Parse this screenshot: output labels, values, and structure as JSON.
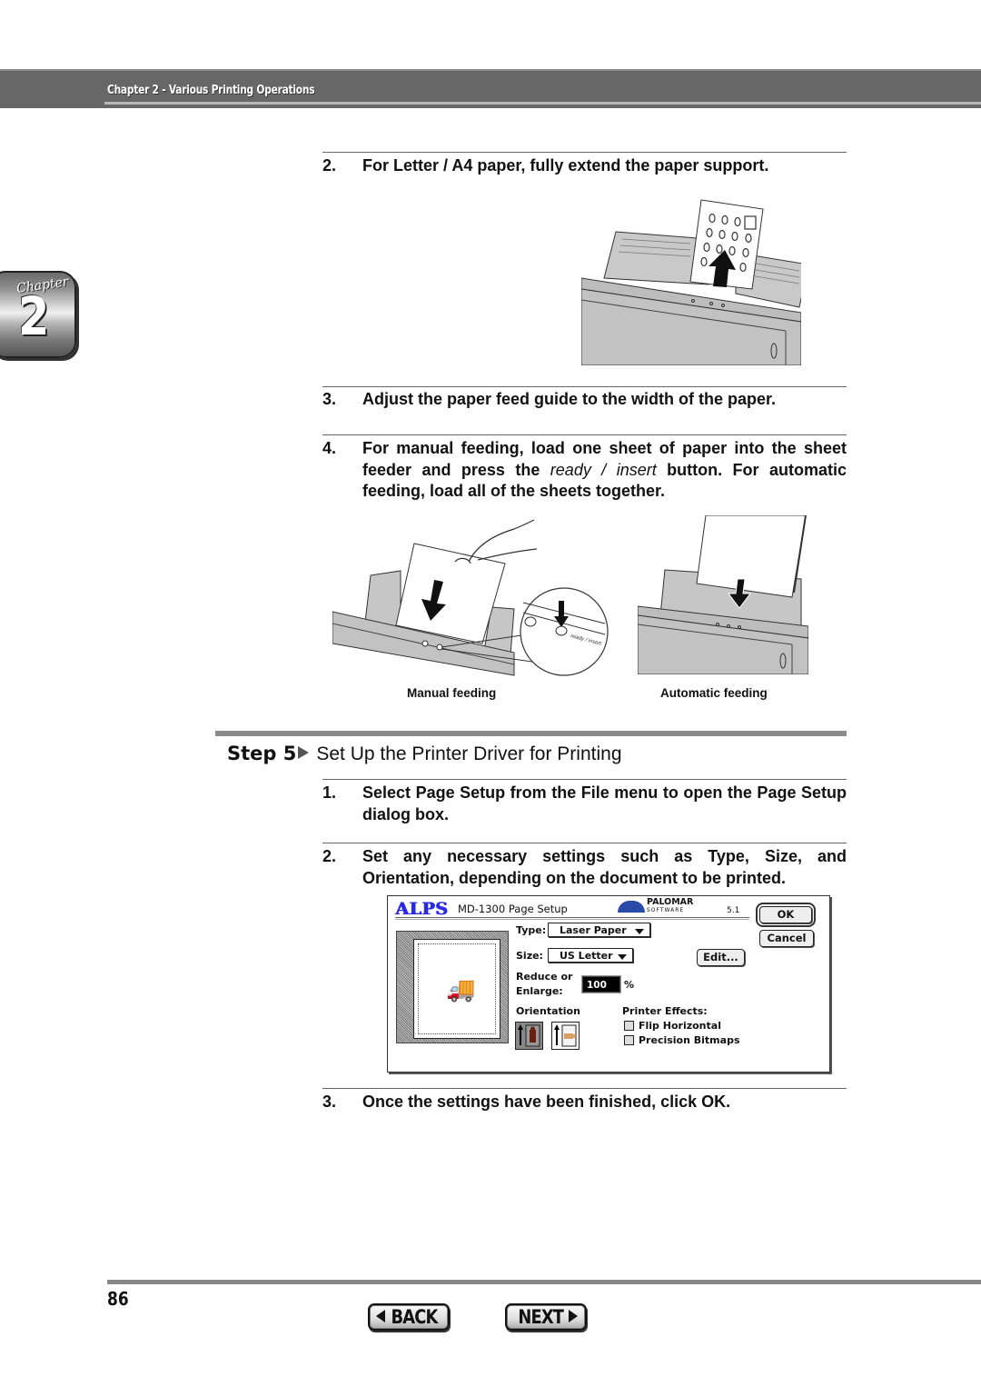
{
  "header": {
    "title": "Chapter 2 - Various Printing Operations"
  },
  "chapter_tab": {
    "word": "Chapter",
    "number": "2"
  },
  "steps_part1": [
    {
      "num": "2.",
      "text": "For Letter / A4 paper, fully extend the paper support."
    },
    {
      "num": "3.",
      "text": "Adjust the paper feed guide to the width of the paper."
    },
    {
      "num": "4.",
      "text_before": "For manual feeding, load one sheet of paper into the sheet feeder and press the ",
      "text_em": "ready / insert",
      "text_after": " button. For automatic feeding, load all of the sheets together."
    }
  ],
  "illustrations": {
    "paper_support": {
      "icon": "paper-support-illustration"
    },
    "manual": {
      "caption": "Manual feeding",
      "button_label": "ready / insert"
    },
    "automatic": {
      "caption": "Automatic feeding"
    }
  },
  "step5": {
    "label": "Step 5",
    "title": "Set Up the Printer Driver for Printing",
    "items": [
      {
        "num": "1.",
        "text": "Select Page Setup from the File menu to open the Page Setup dialog box."
      },
      {
        "num": "2.",
        "text": "Set any necessary settings such as Type, Size, and Orientation, depending on the document to be printed."
      },
      {
        "num": "3.",
        "text": "Once the settings have been finished, click OK."
      }
    ]
  },
  "dialog": {
    "logo": "ALPS",
    "title": "MD-1300 Page Setup",
    "brand": "PALOMAR",
    "brand_sub": "SOFTWARE",
    "version": "5.1",
    "ok_label": "OK",
    "cancel_label": "Cancel",
    "edit_label": "Edit...",
    "type_label": "Type:",
    "type_value": "Laser Paper",
    "size_label": "Size:",
    "size_value": "US Letter",
    "reduce_label_1": "Reduce or",
    "reduce_label_2": "Enlarge:",
    "reduce_value": "100",
    "reduce_unit": "%",
    "orientation_label": "Orientation",
    "effects_label": "Printer Effects:",
    "effects": [
      {
        "label": "Flip Horizontal",
        "checked": false
      },
      {
        "label": "Precision Bitmaps",
        "checked": false
      }
    ]
  },
  "footer": {
    "page_number": "86",
    "back_label": "BACK",
    "next_label": "NEXT"
  }
}
